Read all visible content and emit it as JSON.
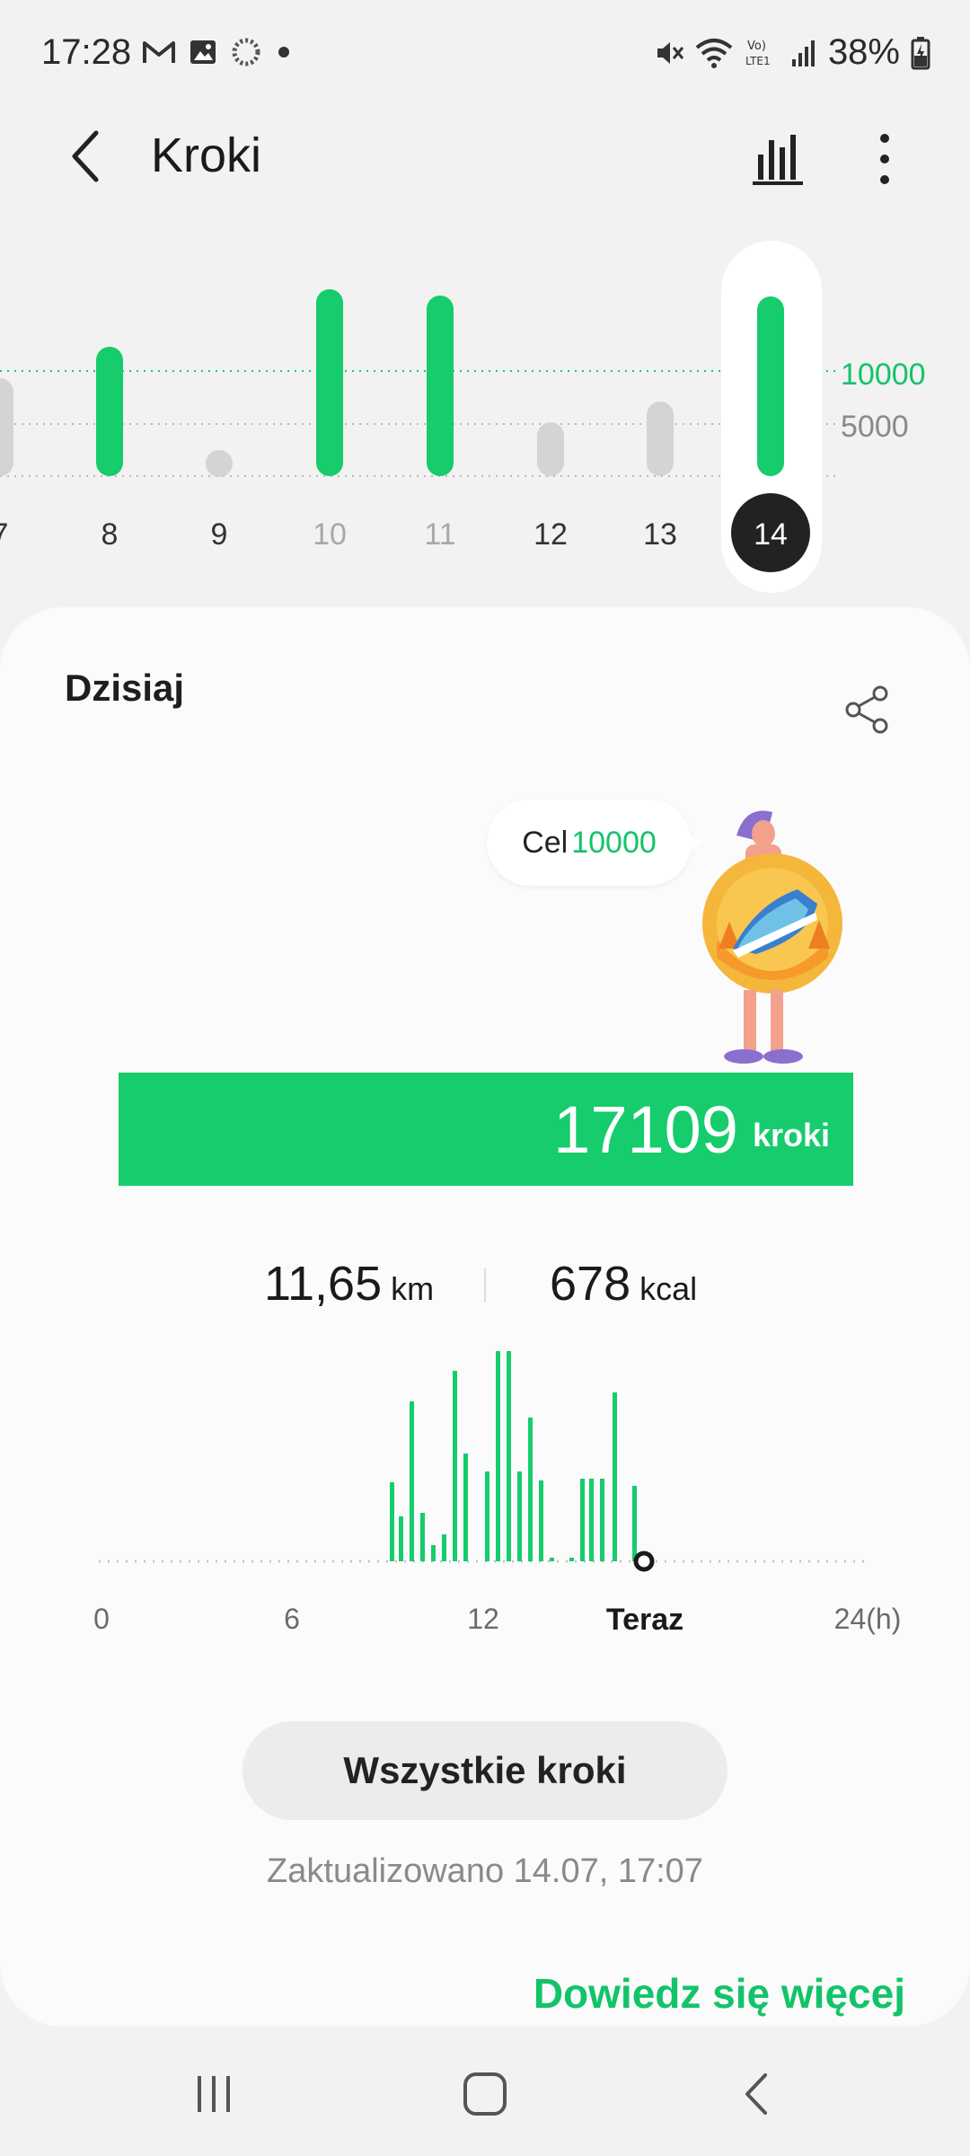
{
  "status_bar": {
    "time": "17:28",
    "battery": "38%",
    "left_icons": [
      "gmail-icon",
      "gallery-icon",
      "sync-icon",
      "dot-icon"
    ],
    "right_icons": [
      "mute-icon",
      "wifi-icon",
      "volte-icon",
      "signal-icon",
      "battery-icon"
    ]
  },
  "app_bar": {
    "title": "Kroki"
  },
  "week_chart": {
    "goal_label": "10000",
    "half_label": "5000",
    "selected_day": "14",
    "days": [
      {
        "label": "7",
        "muted": false
      },
      {
        "label": "8",
        "muted": false
      },
      {
        "label": "9",
        "muted": false
      },
      {
        "label": "10",
        "muted": true
      },
      {
        "label": "11",
        "muted": true
      },
      {
        "label": "12",
        "muted": false
      },
      {
        "label": "13",
        "muted": false
      },
      {
        "label": "14",
        "muted": false
      }
    ]
  },
  "today": {
    "title": "Dzisiaj",
    "goal_prefix": "Cel",
    "goal_value": "10000",
    "steps": "17109",
    "steps_unit": "kroki",
    "distance": "11,65",
    "distance_unit": "km",
    "calories": "678",
    "calories_unit": "kcal",
    "hour_labels": [
      "0",
      "6",
      "12",
      "Teraz",
      "24(h)"
    ],
    "all_steps_button": "Wszystkie kroki",
    "updated": "Zaktualizowano 14.07, 17:07",
    "learn_more": "Dowiedz się więcej"
  },
  "colors": {
    "accent": "#16cc6c",
    "muted_bar": "#d4d4d4"
  }
}
